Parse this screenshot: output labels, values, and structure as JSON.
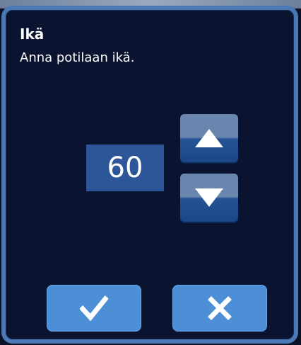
{
  "dialog": {
    "title": "Ikä",
    "subtitle": "Anna potilaan ikä."
  },
  "age_input": {
    "value": "60"
  },
  "buttons": {
    "increment_icon": "triangle-up-icon",
    "decrement_icon": "triangle-down-icon",
    "confirm_icon": "checkmark-icon",
    "cancel_icon": "close-icon"
  },
  "colors": {
    "dialog_background": "#0a1330",
    "dialog_border": "#4a79b5",
    "value_box": "#2d5699",
    "action_button": "#4d8fd6"
  }
}
